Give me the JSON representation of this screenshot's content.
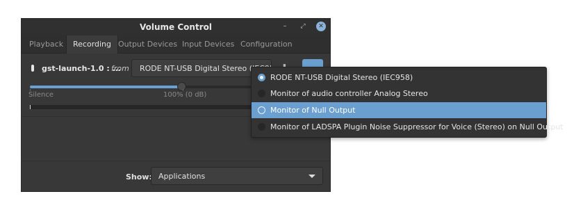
{
  "window": {
    "title": "Volume Control",
    "controls": {
      "minimize": "–",
      "maximize": "⤢",
      "close": "✕"
    }
  },
  "tabs": [
    {
      "label": "Playback",
      "active": false
    },
    {
      "label": "Recording",
      "active": true
    },
    {
      "label": "Output Devices",
      "active": false
    },
    {
      "label": "Input Devices",
      "active": false
    },
    {
      "label": "Configuration",
      "active": false
    }
  ],
  "stream": {
    "name": "gst-launch-1.0 : ...",
    "from_label": "from",
    "source": "RODE NT-USB Digital Stereo (IEC958)",
    "volume_fraction": 0.65,
    "silence_label": "Silence",
    "volume_label": "100% (0 dB)"
  },
  "footer": {
    "show_label": "Show:",
    "show_value": "Applications"
  },
  "popup": {
    "options": [
      {
        "label": "RODE NT-USB Digital Stereo (IEC958)",
        "checked": true,
        "hover": false
      },
      {
        "label": "Monitor of audio controller Analog Stereo",
        "checked": false,
        "hover": false
      },
      {
        "label": "Monitor of Null Output",
        "checked": false,
        "hover": true
      },
      {
        "label": "Monitor of LADSPA Plugin Noise Suppressor for Voice (Stereo) on Null Output",
        "checked": false,
        "hover": false
      }
    ]
  },
  "colors": {
    "accent": "#6a9fcf",
    "window_bg": "#383838",
    "popup_bg": "#333333"
  }
}
